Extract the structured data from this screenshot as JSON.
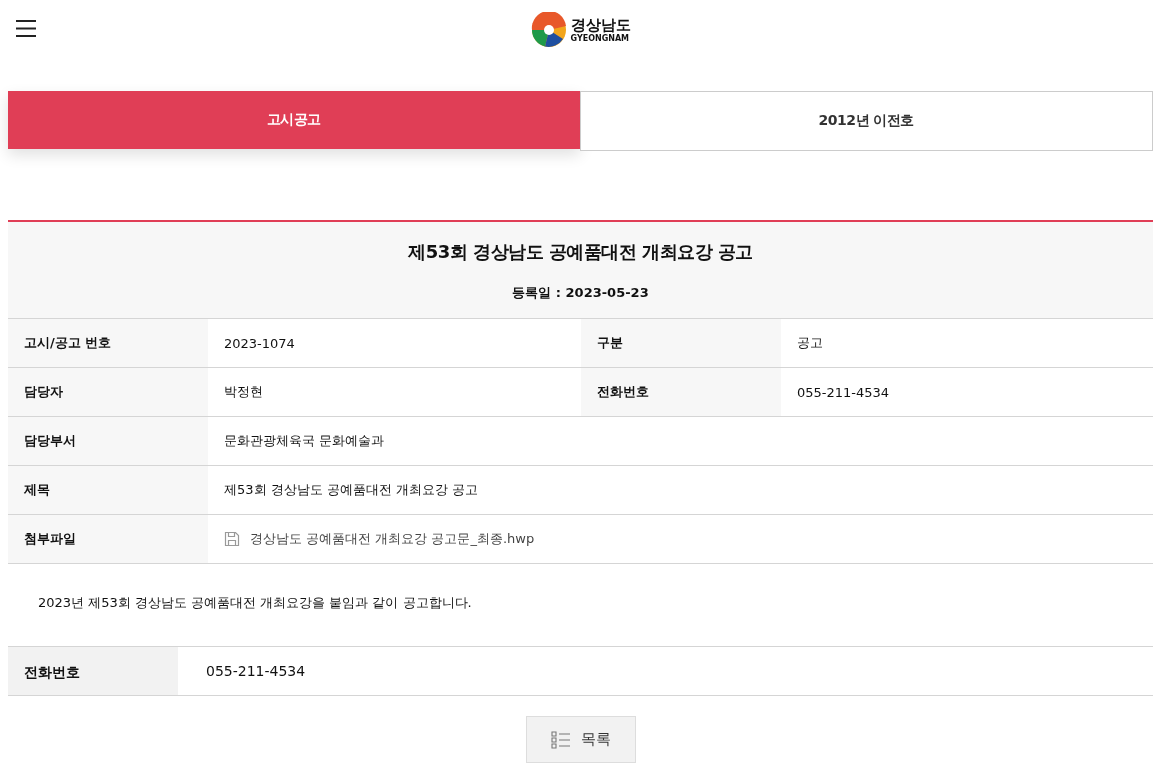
{
  "header": {
    "logo_name": "경상남도",
    "logo_sub": "GYEONGNAM"
  },
  "tabs": [
    {
      "label": "고시공고",
      "selected": true
    },
    {
      "label": "2012년 이전호",
      "selected": false
    }
  ],
  "article": {
    "title": "제53회 경상남도 공예품대전 개최요강 공고",
    "date_label": "등록일 :",
    "date": "2023-05-23",
    "rows": [
      {
        "fields": [
          {
            "label": "고시/공고 번호",
            "value": "2023-1074",
            "kind": "text"
          },
          {
            "label": "구분",
            "value": "공고",
            "kind": "text"
          }
        ]
      },
      {
        "fields": [
          {
            "label": "담당자",
            "value": "박정현",
            "kind": "text"
          },
          {
            "label": "전화번호",
            "value": "055-211-4534",
            "kind": "text"
          }
        ]
      },
      {
        "fields": [
          {
            "label": "담당부서",
            "value": "문화관광체육국 문화예술과",
            "kind": "text"
          }
        ]
      },
      {
        "fields": [
          {
            "label": "제목",
            "value": "제53회 경상남도 공예품대전 개최요강 공고",
            "kind": "text"
          }
        ]
      },
      {
        "fields": [
          {
            "label": "첨부파일",
            "value": "경상남도 공예품대전 개최요강 공고문_최종.hwp",
            "kind": "file"
          }
        ]
      }
    ],
    "body": "2023년 제53회 경상남도 공예품대전 개최요강을 붙임과 같이 공고합니다."
  },
  "contact": {
    "label": "전화번호",
    "value": "055-211-4534"
  },
  "list_button": "목록"
}
